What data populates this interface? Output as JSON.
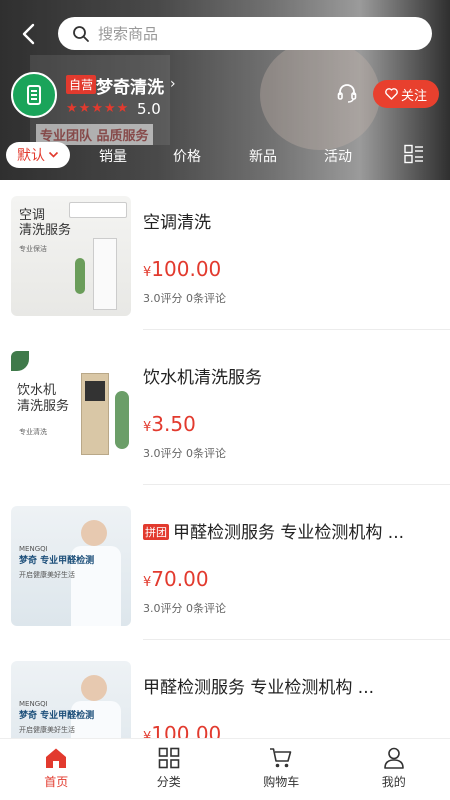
{
  "search": {
    "placeholder": "搜索商品"
  },
  "store": {
    "self_tag": "自营",
    "name": "梦奇清洗",
    "rating": "5.0",
    "follow_label": "关注",
    "banner_text": "专业团队 品质服务"
  },
  "tabs": [
    {
      "label": "默认"
    },
    {
      "label": "销量"
    },
    {
      "label": "价格"
    },
    {
      "label": "新品"
    },
    {
      "label": "活动"
    }
  ],
  "products": [
    {
      "title": "空调清洗",
      "currency": "¥",
      "price": "100.00",
      "meta": "3.0评分 0条评论",
      "thumb_text": [
        "空调",
        "清洗服务"
      ],
      "thumb_sub": "专业保洁"
    },
    {
      "title": "饮水机清洗服务",
      "currency": "¥",
      "price": "3.50",
      "meta": "3.0评分 0条评论",
      "thumb_text": [
        "饮水机",
        "清洗服务"
      ],
      "thumb_sub": "专业清洗"
    },
    {
      "group_tag": "拼团",
      "title": "甲醛检测服务 专业检测机构 ...",
      "currency": "¥",
      "price": "70.00",
      "meta": "3.0评分 0条评论",
      "thumb_brand": "MENGQI",
      "thumb_text": [
        "梦奇 专业甲醛检测"
      ],
      "thumb_sub": "开启健康美好生活"
    },
    {
      "title": "甲醛检测服务 专业检测机构 ...",
      "currency": "¥",
      "price": "100.00",
      "thumb_brand": "MENGQI",
      "thumb_text": [
        "梦奇 专业甲醛检测"
      ],
      "thumb_sub": "开启健康美好生活"
    }
  ],
  "bottom_nav": [
    {
      "label": "首页",
      "icon": "home-icon",
      "active": true
    },
    {
      "label": "分类",
      "icon": "category-grid-icon"
    },
    {
      "label": "购物车",
      "icon": "cart-icon"
    },
    {
      "label": "我的",
      "icon": "user-icon"
    }
  ],
  "colors": {
    "accent": "#e23a2e",
    "logo": "#1aa45a"
  }
}
